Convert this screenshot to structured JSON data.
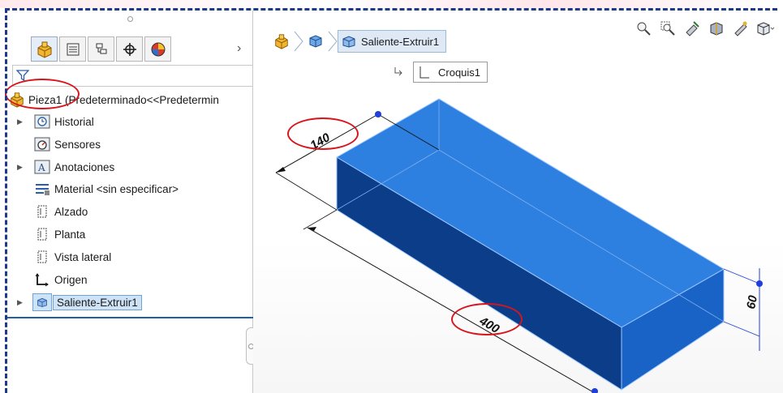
{
  "tabs": [
    {
      "icon": "part-icon",
      "active": true
    },
    {
      "icon": "property-manager-icon"
    },
    {
      "icon": "configuration-manager-icon"
    },
    {
      "icon": "dimxpert-icon"
    },
    {
      "icon": "display-manager-icon"
    }
  ],
  "tree": {
    "root": {
      "name": "Pieza1",
      "config": " (Predeterminado<<Predetermin"
    },
    "items": [
      {
        "label": "Historial",
        "icon": "history-icon",
        "expandable": true
      },
      {
        "label": "Sensores",
        "icon": "sensors-icon",
        "expandable": false
      },
      {
        "label": "Anotaciones",
        "icon": "annotations-icon",
        "expandable": true
      },
      {
        "label": "Material <sin especificar>",
        "icon": "material-icon",
        "expandable": false
      },
      {
        "label": "Alzado",
        "icon": "plane-icon",
        "expandable": false
      },
      {
        "label": "Planta",
        "icon": "plane-icon",
        "expandable": false
      },
      {
        "label": "Vista lateral",
        "icon": "plane-icon",
        "expandable": false
      },
      {
        "label": "Origen",
        "icon": "origin-icon",
        "expandable": false
      },
      {
        "label": "Saliente-Extruir1",
        "icon": "extrude-icon",
        "expandable": true,
        "selected": true
      }
    ]
  },
  "breadcrumb": {
    "feature": "Saliente-Extruir1",
    "sketch": "Croquis1"
  },
  "dimensions": {
    "width": "140",
    "length": "400",
    "height": "60"
  },
  "colors": {
    "body": "#1f6fd1",
    "body_dark": "#0d3f88",
    "callout": "#d8151d",
    "frame": "#1d3a8a"
  }
}
